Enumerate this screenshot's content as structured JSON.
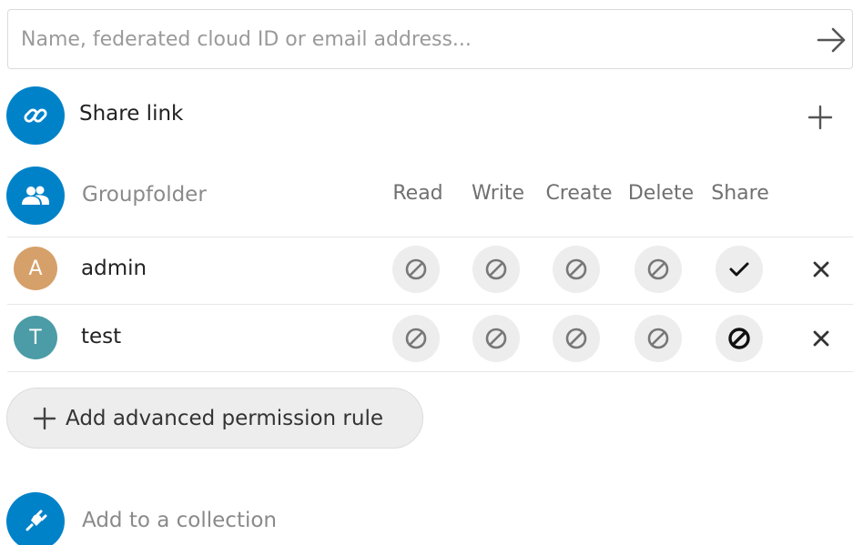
{
  "search": {
    "placeholder": "Name, federated cloud ID or email address...",
    "value": ""
  },
  "share_link": {
    "label": "Share link"
  },
  "groupfolder": {
    "label": "Groupfolder",
    "columns": [
      "Read",
      "Write",
      "Create",
      "Delete",
      "Share"
    ]
  },
  "rules": [
    {
      "initial": "A",
      "name": "admin",
      "avatar_color": "#d6a06a",
      "permissions": [
        "denied",
        "denied",
        "denied",
        "denied",
        "allowed"
      ]
    },
    {
      "initial": "T",
      "name": "test",
      "avatar_color": "#4b9ca6",
      "permissions": [
        "denied",
        "denied",
        "denied",
        "denied",
        "denied-strong"
      ]
    }
  ],
  "advanced_button": {
    "label": "Add advanced permission rule"
  },
  "collection": {
    "label": "Add to a collection"
  },
  "colors": {
    "accent": "#0082c9",
    "permission_bg": "#ededed"
  }
}
